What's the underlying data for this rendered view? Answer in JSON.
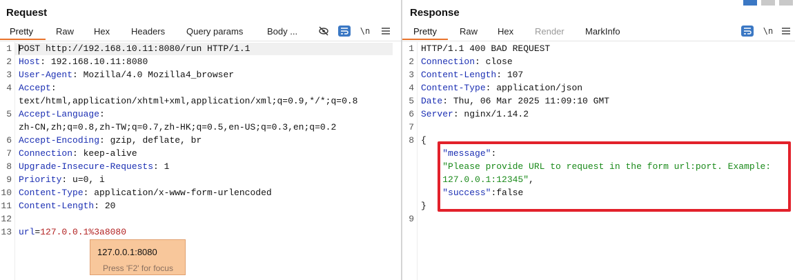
{
  "request": {
    "title": "Request",
    "tabs": [
      "Pretty",
      "Raw",
      "Hex",
      "Headers",
      "Query params",
      "Body ..."
    ],
    "active_tab": "Pretty",
    "lines": [
      {
        "n": "1",
        "parts": [
          [
            "val",
            "POST http://192.168.10.11:8080/run HTTP/1.1"
          ]
        ]
      },
      {
        "n": "2",
        "parts": [
          [
            "hdr",
            "Host"
          ],
          [
            "val",
            ": 192.168.10.11:8080"
          ]
        ]
      },
      {
        "n": "3",
        "parts": [
          [
            "hdr",
            "User-Agent"
          ],
          [
            "val",
            ": Mozilla/4.0 Mozilla4_browser"
          ]
        ]
      },
      {
        "n": "4",
        "parts": [
          [
            "hdr",
            "Accept"
          ],
          [
            "val",
            ":"
          ]
        ]
      },
      {
        "n": "",
        "parts": [
          [
            "val",
            "text/html,application/xhtml+xml,application/xml;q=0.9,*/*;q=0.8"
          ]
        ]
      },
      {
        "n": "5",
        "parts": [
          [
            "hdr",
            "Accept-Language"
          ],
          [
            "val",
            ":"
          ]
        ]
      },
      {
        "n": "",
        "parts": [
          [
            "val",
            "zh-CN,zh;q=0.8,zh-TW;q=0.7,zh-HK;q=0.5,en-US;q=0.3,en;q=0.2"
          ]
        ]
      },
      {
        "n": "6",
        "parts": [
          [
            "hdr",
            "Accept-Encoding"
          ],
          [
            "val",
            ": gzip, deflate, br"
          ]
        ]
      },
      {
        "n": "7",
        "parts": [
          [
            "hdr",
            "Connection"
          ],
          [
            "val",
            ": keep-alive"
          ]
        ]
      },
      {
        "n": "8",
        "parts": [
          [
            "hdr",
            "Upgrade-Insecure-Requests"
          ],
          [
            "val",
            ": 1"
          ]
        ]
      },
      {
        "n": "9",
        "parts": [
          [
            "hdr",
            "Priority"
          ],
          [
            "val",
            ": u=0, i"
          ]
        ]
      },
      {
        "n": "10",
        "parts": [
          [
            "hdr",
            "Content-Type"
          ],
          [
            "val",
            ": application/x-www-form-urlencoded"
          ]
        ]
      },
      {
        "n": "11",
        "parts": [
          [
            "hdr",
            "Content-Length"
          ],
          [
            "val",
            ": 20"
          ]
        ]
      },
      {
        "n": "12",
        "parts": []
      },
      {
        "n": "13",
        "parts": [
          [
            "body-key",
            "url"
          ],
          [
            "val",
            "="
          ],
          [
            "body-val",
            "127.0.0.1%3a8080"
          ]
        ]
      }
    ],
    "tooltip": {
      "value": "127.0.0.1:8080",
      "hint": "Press 'F2' for focus"
    }
  },
  "response": {
    "title": "Response",
    "tabs": [
      "Pretty",
      "Raw",
      "Hex",
      "Render",
      "MarkInfo"
    ],
    "active_tab": "Pretty",
    "lines": [
      {
        "n": "1",
        "parts": [
          [
            "val",
            "HTTP/1.1 400 BAD REQUEST"
          ]
        ]
      },
      {
        "n": "2",
        "parts": [
          [
            "hdr",
            "Connection"
          ],
          [
            "val",
            ": close"
          ]
        ]
      },
      {
        "n": "3",
        "parts": [
          [
            "hdr",
            "Content-Length"
          ],
          [
            "val",
            ": 107"
          ]
        ]
      },
      {
        "n": "4",
        "parts": [
          [
            "hdr",
            "Content-Type"
          ],
          [
            "val",
            ": application/json"
          ]
        ]
      },
      {
        "n": "5",
        "parts": [
          [
            "hdr",
            "Date"
          ],
          [
            "val",
            ": Thu, 06 Mar 2025 11:09:10 GMT"
          ]
        ]
      },
      {
        "n": "6",
        "parts": [
          [
            "hdr",
            "Server"
          ],
          [
            "val",
            ": nginx/1.14.2"
          ]
        ]
      },
      {
        "n": "7",
        "parts": []
      },
      {
        "n": "8",
        "parts": [
          [
            "val",
            "{"
          ]
        ]
      },
      {
        "n": "",
        "parts": [
          [
            "val",
            "    "
          ],
          [
            "json-key",
            "\"message\""
          ],
          [
            "val",
            ":"
          ]
        ]
      },
      {
        "n": "",
        "parts": [
          [
            "val",
            "    "
          ],
          [
            "json-str",
            "\"Please provide URL to request in the form url:port. Example:"
          ]
        ]
      },
      {
        "n": "",
        "parts": [
          [
            "val",
            "    "
          ],
          [
            "json-str",
            "127.0.0.1:12345\""
          ],
          [
            "val",
            ","
          ]
        ]
      },
      {
        "n": "",
        "parts": [
          [
            "val",
            "    "
          ],
          [
            "json-key",
            "\"success\""
          ],
          [
            "val",
            ":false"
          ]
        ]
      },
      {
        "n": "",
        "parts": [
          [
            "val",
            "}"
          ]
        ]
      },
      {
        "n": "9",
        "parts": []
      }
    ]
  },
  "colors": {
    "accent": "#e8722a",
    "highlight_box": "#e2212b",
    "header_key": "#1b2fb3",
    "json_string": "#1a8a1a"
  }
}
